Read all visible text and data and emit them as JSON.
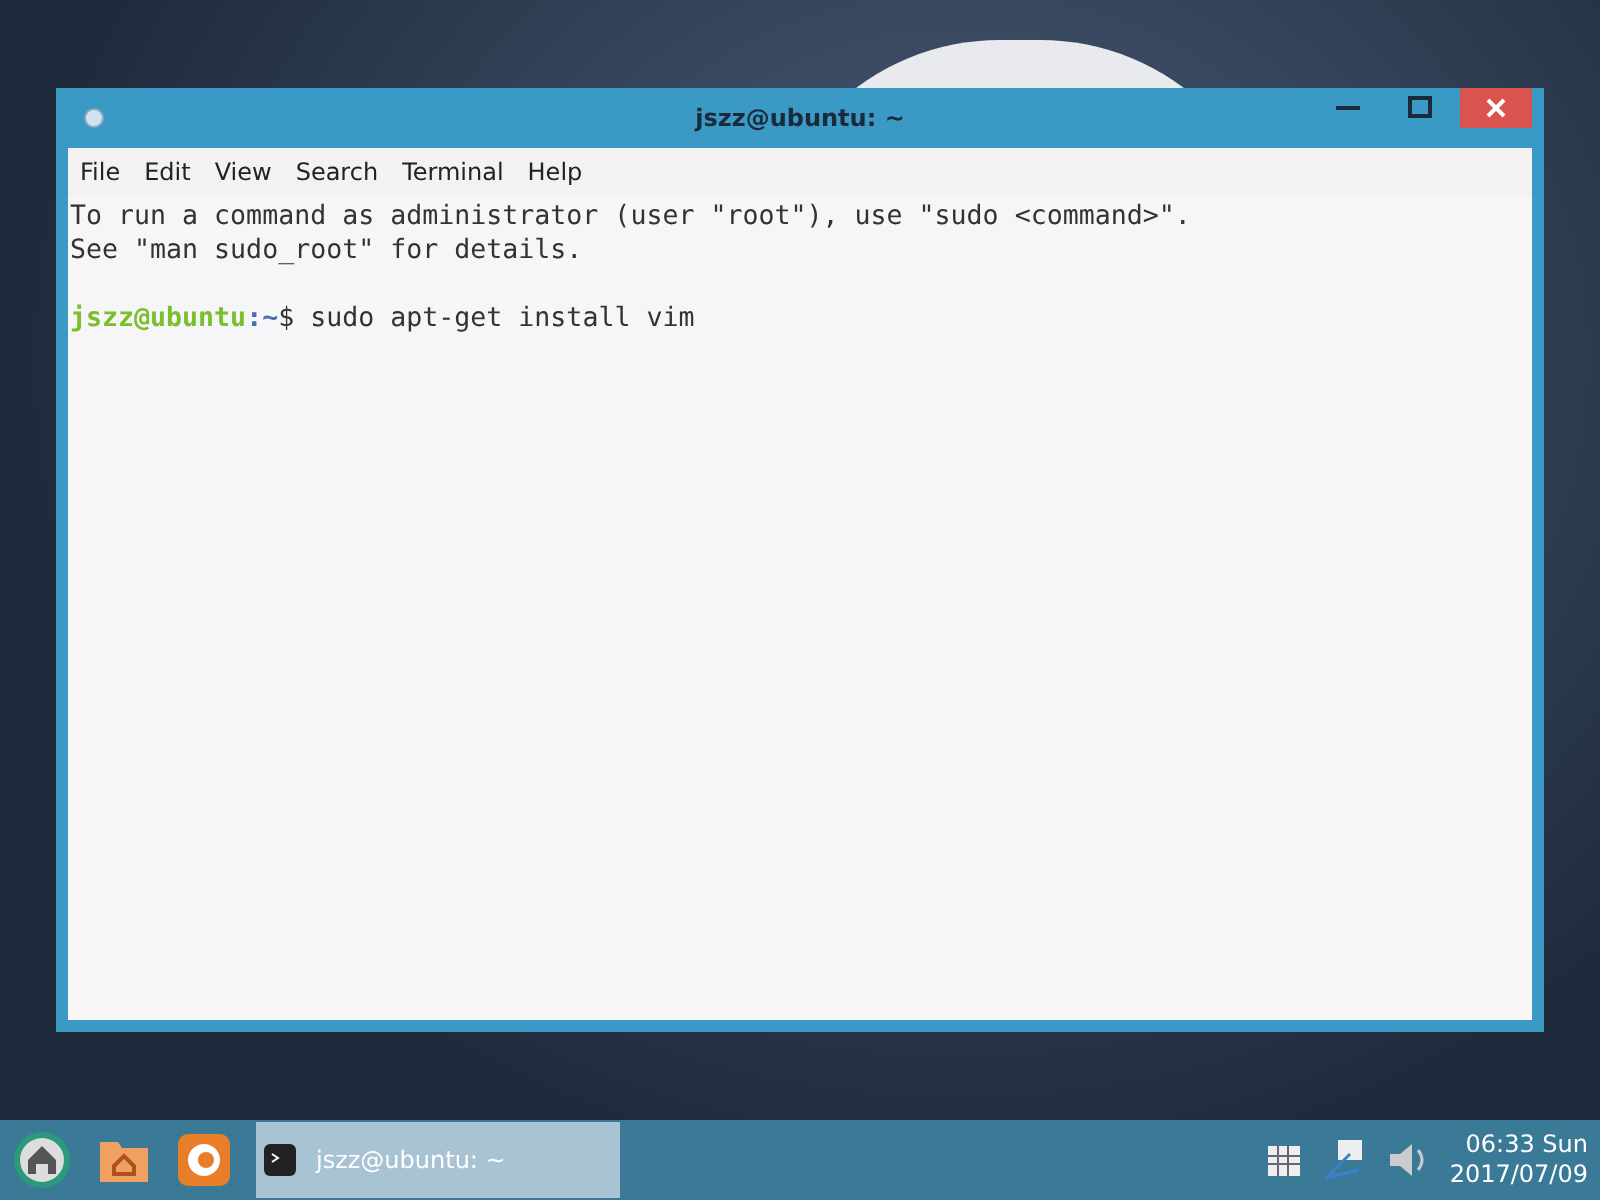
{
  "window": {
    "title": "jszz@ubuntu: ~"
  },
  "menu": [
    "File",
    "Edit",
    "View",
    "Search",
    "Terminal",
    "Help"
  ],
  "terminal": {
    "lines": [
      {
        "kind": "text",
        "text": "To run a command as administrator (user \"root\"), use \"sudo <command>\"."
      },
      {
        "kind": "text",
        "text": "See \"man sudo_root\" for details."
      },
      {
        "kind": "blank"
      },
      {
        "kind": "prompt",
        "user": "jszz@ubuntu",
        "path": ":~",
        "symbol": "$",
        "command": " sudo apt-get install vim"
      }
    ]
  },
  "taskbar": {
    "tasks": [
      {
        "label": "jszz@ubuntu: ~",
        "selected": true
      }
    ],
    "clock": {
      "time": "06:33 Sun",
      "date": "2017/07/09"
    }
  }
}
